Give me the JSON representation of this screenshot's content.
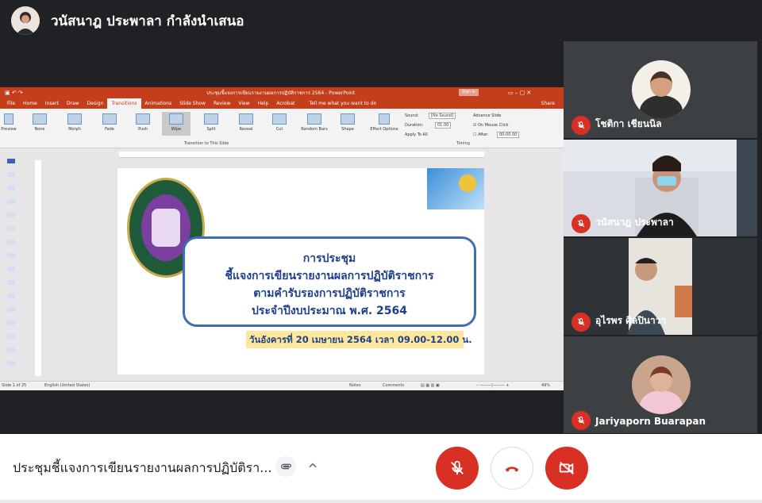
{
  "topbar": {
    "presenter_text": "วนัสนาฎ ประพาลา กำลังนำเสนอ"
  },
  "ppt": {
    "title": "ประชุมชี้แจงการเขียนรายงานผลการปฏิบัติราชการ 2564 - PowerPoint",
    "signin": "Sign in",
    "tabs": [
      "File",
      "Home",
      "Insert",
      "Draw",
      "Design",
      "Transitions",
      "Animations",
      "Slide Show",
      "Review",
      "View",
      "Help",
      "Acrobat"
    ],
    "tell_me": "Tell me what you want to do",
    "share": "Share",
    "preview": "Preview",
    "effects": [
      "None",
      "Morph",
      "Fade",
      "Push",
      "Wipe",
      "Split",
      "Reveal",
      "Cut",
      "Random Bars",
      "Shape"
    ],
    "effect_options": "Effect Options",
    "group_label_transition": "Transition to This Slide",
    "group_label_timing": "Timing",
    "sound_label": "Sound:",
    "sound_value": "[No Sound]",
    "duration_label": "Duration:",
    "duration_value": "01.00",
    "apply_all": "Apply To All",
    "advance_slide": "Advance Slide",
    "on_mouse_click": "On Mouse Click",
    "after_label": "After:",
    "after_value": "00:00.00",
    "slide": {
      "line1": "การประชุม",
      "line2": "ชี้แจงการเขียนรายงานผลการปฏิบัติราชการ",
      "line3": "ตามคำรับรองการปฏิบัติราชการ",
      "line4": "ประจำปีงบประมาณ พ.ศ. 2564",
      "date": "วันอังคารที่ 20 เมษายน  2564 เวลา 09.00-12.00  น."
    },
    "status": {
      "slide_count": "Slide 1 of 25",
      "language": "English (United States)",
      "notes": "Notes",
      "comments": "Comments",
      "zoom": "49%"
    }
  },
  "participants": [
    {
      "name": "โชติกา เชียนนิล"
    },
    {
      "name": "วนัสนาฎ ประพาลา"
    },
    {
      "name": "อุไรพร ศิลปินาวา"
    },
    {
      "name": "Jariyaporn Buarapan"
    }
  ],
  "bottom": {
    "meeting_title": "ประชุมชี้แจงการเขียนรายงานผลการปฏิบัติรา..."
  },
  "colors": {
    "mute_red": "#d93025",
    "ppt_orange": "#c43e1c"
  }
}
